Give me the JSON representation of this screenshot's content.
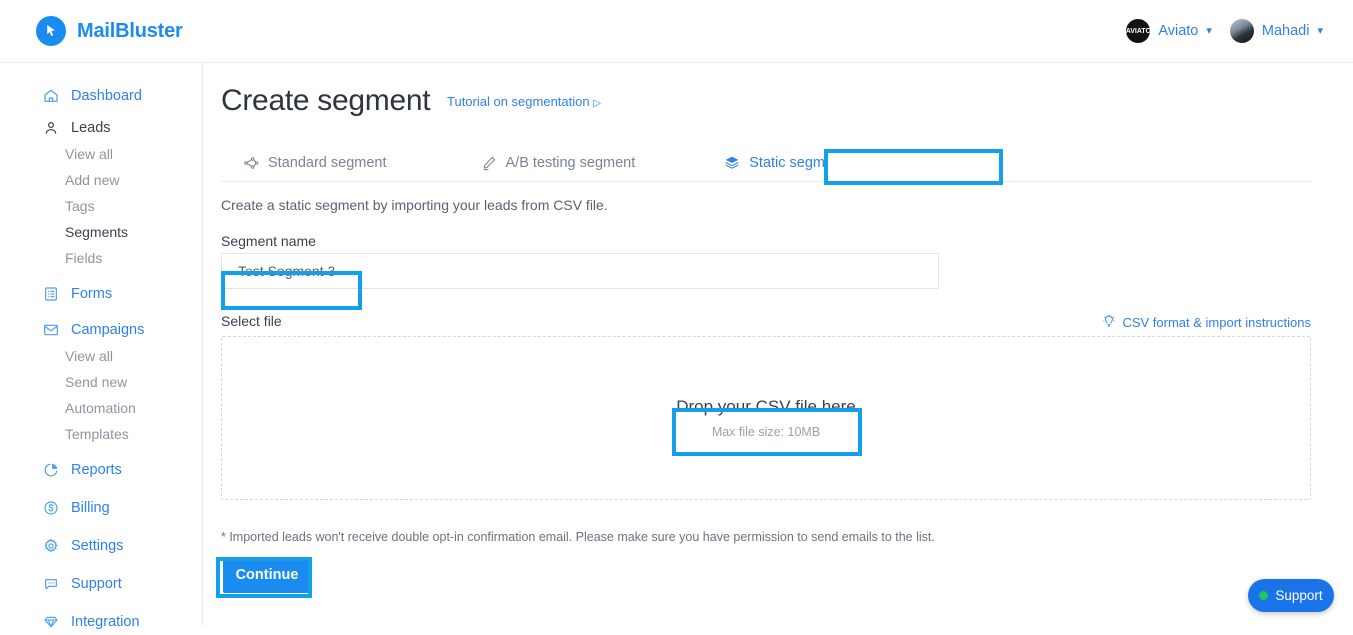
{
  "brand": {
    "name": "MailBluster",
    "logo_icon": "cursor-arrow-icon",
    "color": "#1a8cf0"
  },
  "topbar": {
    "accounts": [
      {
        "name": "Aviato",
        "avatar_icon": "aviato-logo-avatar",
        "caret_icon": "chevron-down-icon"
      },
      {
        "name": "Mahadi",
        "avatar_icon": "user-photo-avatar",
        "caret_icon": "chevron-down-icon"
      }
    ]
  },
  "sidebar": {
    "items": [
      {
        "label": "Dashboard",
        "icon": "home-icon"
      },
      {
        "label": "Leads",
        "icon": "user-icon",
        "style": "dark"
      },
      {
        "label": "Forms",
        "icon": "form-list-icon"
      },
      {
        "label": "Campaigns",
        "icon": "envelope-icon"
      },
      {
        "label": "Reports",
        "icon": "pie-chart-icon"
      },
      {
        "label": "Billing",
        "icon": "dollar-circle-icon"
      },
      {
        "label": "Settings",
        "icon": "gear-icon"
      },
      {
        "label": "Support",
        "icon": "chat-bubble-icon"
      },
      {
        "label": "Integration",
        "icon": "gem-icon"
      }
    ],
    "leads_sub": [
      {
        "label": "View all",
        "active": false
      },
      {
        "label": "Add new",
        "active": false
      },
      {
        "label": "Tags",
        "active": false
      },
      {
        "label": "Segments",
        "active": true
      },
      {
        "label": "Fields",
        "active": false
      }
    ],
    "campaigns_sub": [
      {
        "label": "View all",
        "active": false
      },
      {
        "label": "Send new",
        "active": false
      },
      {
        "label": "Automation",
        "active": false
      },
      {
        "label": "Templates",
        "active": false
      }
    ]
  },
  "main": {
    "title": "Create segment",
    "tutorial_link": "Tutorial on segmentation",
    "tutorial_play_icon": "play-triangle-icon",
    "tabs": [
      {
        "label": "Standard segment",
        "icon": "node-graph-icon",
        "active": false
      },
      {
        "label": "A/B testing segment",
        "icon": "pen-icon",
        "active": false
      },
      {
        "label": "Static segment",
        "icon": "layers-stack-icon",
        "active": true
      }
    ],
    "description": "Create a static segment by importing your leads from CSV file.",
    "segment_name_label": "Segment name",
    "segment_name_value": "Test Segment 3",
    "segment_name_placeholder": "Segment name",
    "select_file_label": "Select file",
    "csv_instructions_link": "CSV format & import instructions",
    "csv_instructions_icon": "lightbulb-icon",
    "dropzone_title": "Drop your CSV file here",
    "dropzone_subtitle": "Max file size: 10MB",
    "footnote": "* Imported leads won't receive double opt-in confirmation email. Please make sure you have permission to send emails to the list.",
    "continue_label": "Continue"
  },
  "support_widget": {
    "label": "Support",
    "status_icon": "online-status-dot",
    "status_color": "#22c55e"
  },
  "annotations": {
    "highlight_color": "#12a0e8"
  }
}
